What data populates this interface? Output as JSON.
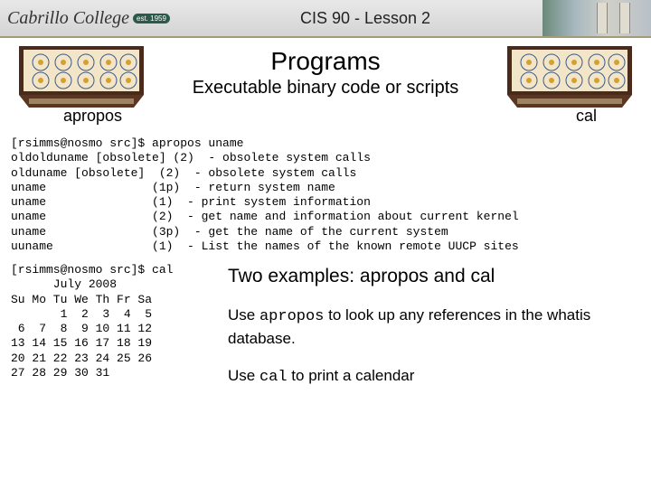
{
  "header": {
    "logo_text": "Cabrillo College",
    "logo_est": "est. 1959",
    "title": "CIS 90 - Lesson 2"
  },
  "titles": {
    "main": "Programs",
    "sub": "Executable binary code or scripts"
  },
  "labels": {
    "left": "apropos",
    "right": "cal"
  },
  "terminal_apropos": "[rsimms@nosmo src]$ apropos uname\noldolduname [obsolete] (2)  - obsolete system calls\nolduname [obsolete]  (2)  - obsolete system calls\nuname               (1p)  - return system name\nuname               (1)  - print system information\nuname               (2)  - get name and information about current kernel\nuname               (3p)  - get the name of the current system\nuuname              (1)  - List the names of the known remote UUCP sites",
  "terminal_cal": "[rsimms@nosmo src]$ cal\n      July 2008\nSu Mo Tu We Th Fr Sa\n       1  2  3  4  5\n 6  7  8  9 10 11 12\n13 14 15 16 17 18 19\n20 21 22 23 24 25 26\n27 28 29 30 31",
  "explain": {
    "heading": "Two examples: apropos and cal",
    "p1a": "Use ",
    "p1cmd": "apropos",
    "p1b": " to look up any references in the whatis database.",
    "p2a": "Use ",
    "p2cmd": "cal",
    "p2b": " to print a calendar"
  }
}
